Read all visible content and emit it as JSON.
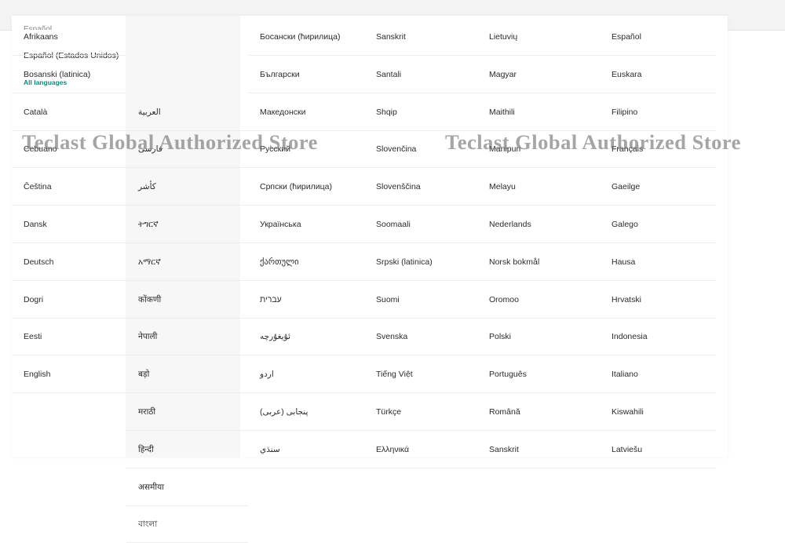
{
  "top_partial_label": "Español",
  "sidebar": {
    "selected_language": "Español (Estados Unidos)",
    "all_languages_label": "All languages"
  },
  "watermark": "Teclast Global Authorized Store",
  "columns": [
    {
      "items": [
        "Afrikaans",
        "Bosanski (latinica)",
        "Català",
        "Cebuano",
        "Čeština",
        "Dansk",
        "Deutsch",
        "Dogri",
        "Eesti",
        "English"
      ]
    },
    {
      "items": [
        "العربية",
        "فارسی",
        "کأشر",
        "ትግርኛ",
        "አማርኛ",
        "कोंकणी",
        "नेपाली",
        "बड़ो",
        "मराठी",
        "हिन्दी",
        "असमीया",
        "বাংলা"
      ]
    },
    {
      "items": [
        "Босански (ћирилица)",
        "Български",
        "Македонски",
        "Русский",
        "Српски (ћирилица)",
        "Українська",
        "ქართული",
        "עברית",
        "ئۇيغۇرچە",
        "اردو",
        "پنجابی (عربی)",
        "سنڌي"
      ]
    },
    {
      "items": [
        "Sanskrit",
        "Santali",
        "Shqip",
        "Slovenčina",
        "Slovenščina",
        "Soomaali",
        "Srpski (latinica)",
        "Suomi",
        "Svenska",
        "Tiếng Việt",
        "Türkçe",
        "Ελληνικά"
      ]
    },
    {
      "items": [
        "Lietuvių",
        "Magyar",
        "Maithili",
        "Manipuri",
        "Melayu",
        "Nederlands",
        "Norsk bokmål",
        "Oromoo",
        "Polski",
        "Português",
        "Română",
        "Sanskrit"
      ]
    },
    {
      "items": [
        "Español",
        "Euskara",
        "Filipino",
        "Français",
        "Gaeilge",
        "Galego",
        "Hausa",
        "Hrvatski",
        "Indonesia",
        "Italiano",
        "Kiswahili",
        "Latviešu"
      ]
    }
  ]
}
